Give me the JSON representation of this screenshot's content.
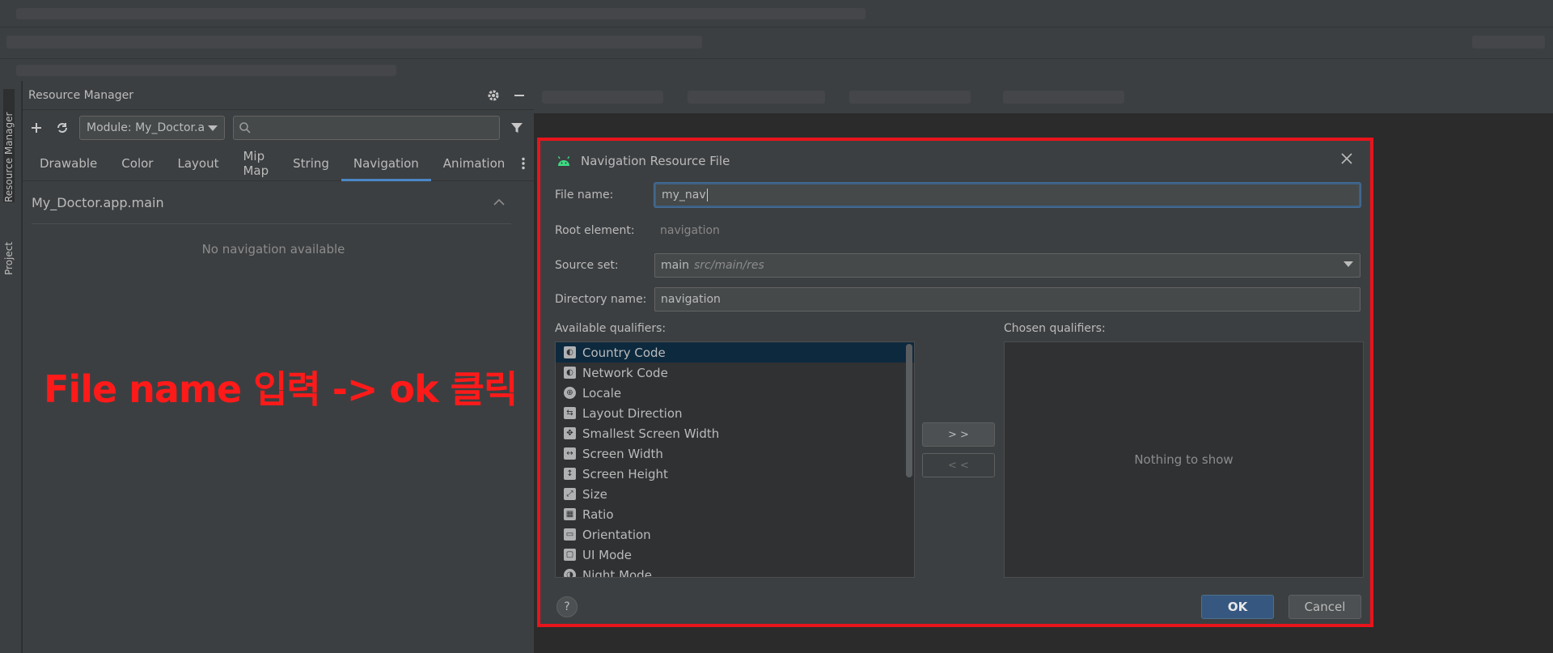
{
  "resource_manager": {
    "title": "Resource Manager",
    "module_select": "Module: My_Doctor.a",
    "tabs": [
      "Drawable",
      "Color",
      "Layout",
      "Mip Map",
      "String",
      "Navigation",
      "Animation"
    ],
    "active_tab": "Navigation",
    "group_title": "My_Doctor.app.main",
    "empty_message": "No navigation available"
  },
  "side_tabs": {
    "resource_manager": "Resource Manager",
    "project": "Project"
  },
  "annotation": "File name 입력 -> ok 클릭",
  "dialog": {
    "title": "Navigation Resource File",
    "file_name_label": "File name:",
    "file_name_value": "my_nav",
    "root_element_label": "Root element:",
    "root_element_value": "navigation",
    "source_set_label": "Source set:",
    "source_set_value": "main",
    "source_set_path": "src/main/res",
    "directory_label": "Directory name:",
    "directory_value": "navigation",
    "available_label": "Available qualifiers:",
    "chosen_label": "Chosen qualifiers:",
    "qualifiers": [
      "Country Code",
      "Network Code",
      "Locale",
      "Layout Direction",
      "Smallest Screen Width",
      "Screen Width",
      "Screen Height",
      "Size",
      "Ratio",
      "Orientation",
      "UI Mode",
      "Night Mode"
    ],
    "add_button": "> >",
    "remove_button": "< <",
    "chosen_empty": "Nothing to show",
    "help_label": "?",
    "ok_label": "OK",
    "cancel_label": "Cancel"
  },
  "colors": {
    "highlight_border": "#e8141c",
    "annotation_text": "#ff1a1a",
    "tab_underline": "#4a88c7",
    "ok_button": "#365880"
  }
}
